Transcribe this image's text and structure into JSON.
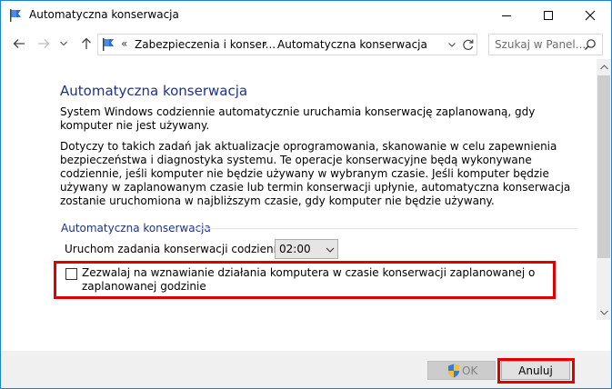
{
  "window": {
    "title": "Automatyczna konserwacja",
    "controls": {
      "minimize": "—",
      "maximize": "☐",
      "close": "✕"
    }
  },
  "nav": {
    "back_icon": "arrow-left-icon",
    "forward_icon": "arrow-right-icon",
    "recent_icon": "chevron-down-icon",
    "up_icon": "arrow-up-icon"
  },
  "address": {
    "overflow": "«",
    "crumbs": [
      "Zabezpieczenia i konser...",
      "Automatyczna konserwacja"
    ],
    "separator": "›"
  },
  "search": {
    "placeholder": "Szukaj w Panel..."
  },
  "main": {
    "heading": "Automatyczna konserwacja",
    "para1": "System Windows codziennie automatycznie uruchamia konserwację zaplanowaną, gdy komputer nie jest używany.",
    "para2": "Dotyczy to takich zadań jak aktualizacje oprogramowania, skanowanie w celu zapewnienia bezpieczeństwa i diagnostyka systemu. Te operacje konserwacyjne będą wykonywane codziennie, jeśli komputer nie będzie używany w wybranym czasie. Jeśli komputer będzie używany w zaplanowanym czasie lub termin konserwacji upłynie, automatyczna konserwacja zostanie uruchomiona w najbliższym czasie, gdy komputer nie będzie używany.",
    "section_label": "Automatyczna konserwacja",
    "time_label": "Uruchom zadania konserwacji codziennie o",
    "time_value": "02:00",
    "wake_label": "Zezwalaj na wznawianie działania komputera w czasie konserwacji zaplanowanej o zaplanowanej godzinie",
    "wake_checked": false
  },
  "footer": {
    "ok_label": "OK",
    "cancel_label": "Anuluj"
  },
  "colors": {
    "accent": "#1e3287",
    "highlight": "#e00000",
    "window_border": "#1883d7"
  }
}
